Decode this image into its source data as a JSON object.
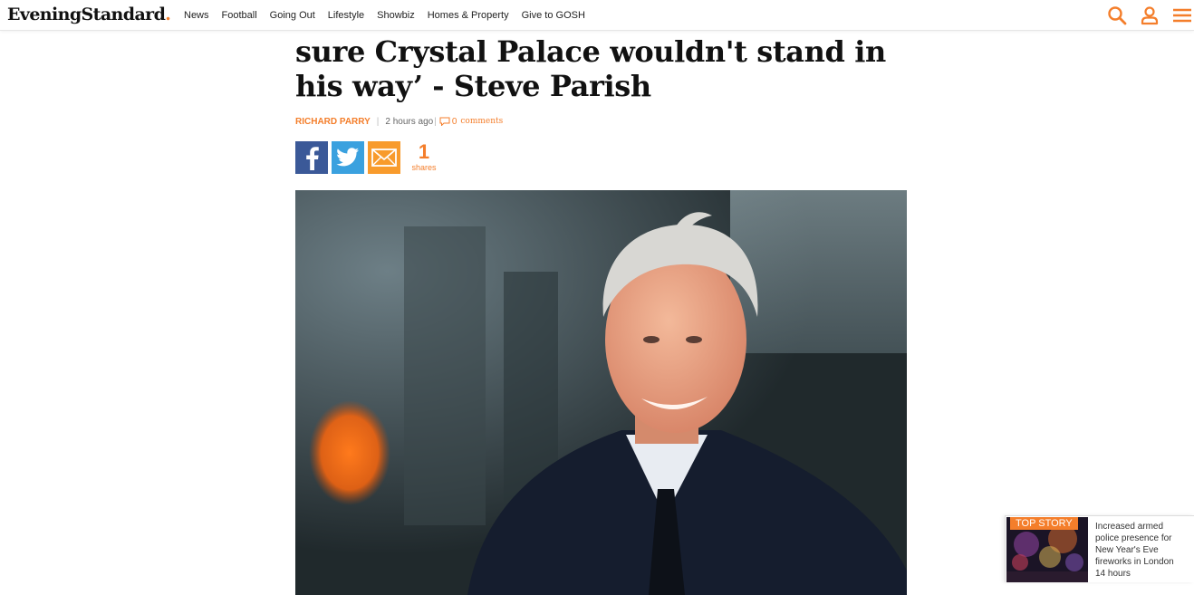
{
  "header": {
    "logo_text": "EveningStandard",
    "logo_dot": ".",
    "nav": [
      "News",
      "Football",
      "Going Out",
      "Lifestyle",
      "Showbiz",
      "Homes & Property",
      "Give to GOSH"
    ],
    "icons": [
      "search-icon",
      "user-icon",
      "menu-icon"
    ]
  },
  "article": {
    "headline_line1": "sure Crystal Palace wouldn't stand in",
    "headline_line2": "his way’ - Steve Parish",
    "author": "RICHARD PARRY",
    "time": "2 hours  ago",
    "comments_count": "0",
    "comments_label": "comments",
    "share_count": "1",
    "share_label": "shares",
    "share_buttons": [
      "facebook-icon",
      "twitter-icon",
      "email-icon"
    ]
  },
  "top_story": {
    "badge": "TOP STORY",
    "line1": "Increased armed",
    "line2": "police presence for",
    "line3": "New Year's Eve",
    "line4": "fireworks in London",
    "time": "14 hours"
  },
  "colors": {
    "accent": "#f47e2b",
    "facebook": "#3b5998",
    "twitter": "#3aa1df",
    "email": "#f89b2c",
    "text": "#111111"
  }
}
